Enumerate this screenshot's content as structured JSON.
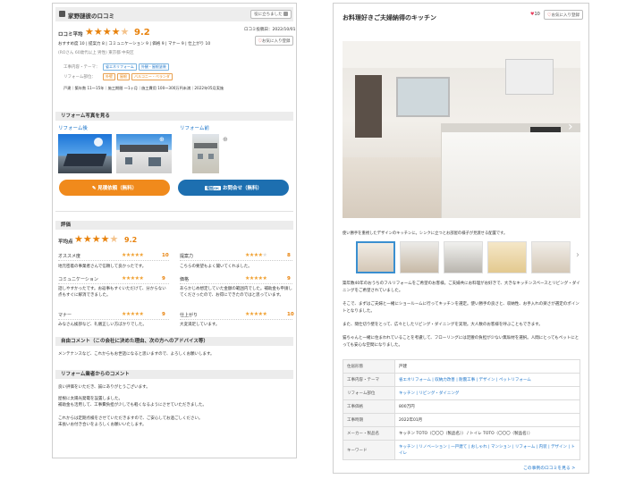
{
  "left": {
    "title": "家野謎彼のロコミ",
    "helpful_button": "役に立ちました",
    "rating_label": "ロコミ平均",
    "rating_value": "9.2",
    "posted_date": "ロコミ投稿日：2022/10/01",
    "fav_button": "お気に入り登録",
    "sub_scores": "おすすめ度 10 | 提案力 8 | コミュニケーション 9 | 価格 9 | マナー 9 | 仕上がり 10",
    "user_meta": "(ROさん 60歳代以上 男性) 東京都 中央区",
    "info": {
      "label1": "工事内容・テーマ：",
      "tags1": [
        "省エネリフォーム",
        "外観・屋根塗装"
      ],
      "label2": "リフォーム部位：",
      "tags2": [
        "外壁",
        "屋根",
        "バルコニー・ベランダ"
      ],
      "details": "戸建｜築年数 11〜15年｜施工期間 〜1ヶ月｜施工費用 100〜300万円未満｜2022年05月実施"
    },
    "photos_head": "リフォーム写真を見る",
    "after_label": "リフォーム後",
    "before_label": "リフォーム前",
    "estimate_button": "見積依頼（無料）",
    "inquiry_badge": "電話OK",
    "inquiry_button": "お問合せ（無料）",
    "eval_head": "評価",
    "avg_label": "平均点",
    "avg_value": "9.2",
    "evals": [
      {
        "name": "オススメ度",
        "score": "10",
        "text": "地元密着の事業者さんで信頼して良かったです。"
      },
      {
        "name": "提案力",
        "score": "8",
        "text": "こちらの要望もよく聞いてくれました。"
      },
      {
        "name": "コミュニケーション",
        "score": "9",
        "text": "話しやすかったです。お返事もすぐいただけて、分からない点もすぐに解消できました。"
      },
      {
        "name": "価格",
        "score": "9",
        "text": "あらかじめ想定していた金額の範囲内でした。補助金も申請してくださったので、お得にできたのではと思っています。"
      },
      {
        "name": "マナー",
        "score": "9",
        "text": "みなさん挨拶など、礼儀正しい方ばかりでした。"
      },
      {
        "name": "仕上がり",
        "score": "10",
        "text": "大変満足しています。"
      }
    ],
    "free_head": "自由コメント（この会社に決めた理由、次の方へのアドバイス等）",
    "free_text": "メンテナンスなど、これからもお世話になると思いますので、よろしくお願いします。",
    "company_head": "リフォーム業者からのコメント",
    "company_text": [
      "良い評価をいただき、誠にありがとうございます。",
      "屋根に太陽光発電を設置しました。\n補助金も活用して、工事費負担が少しでも軽くなるようにさせていただきました。",
      "これからは定期点検をさせていただきますので、ご安心してお過ごしください。\n末長いお付き合いをよろしくお願いいたします。"
    ]
  },
  "right": {
    "title": "お料理好きご夫婦納得のキッチン",
    "likes": "10",
    "fav_button": "お気に入り登録",
    "caption": "使い勝手を重視したデザインのキッチンに。シンクに立つとお部屋の様子が見渡せる配置です。",
    "desc1": "築年数40年のおうちのフルリフォームをご希望のお客様。ご夫婦共にお料理がお好きで、大きなキッチンスペースとリビング・ダイニングをご希望されていました。",
    "desc2": "そこで、まずはご夫婦と一緒にショールームに行ってキッチンを選定。使い勝手の良さと、収納性、お手入れの楽さが選定のポイントとなりました。",
    "desc3": "また、間仕切り壁をとって、広々としたリビング・ダイニングを実現。大人数のお客様を呼ぶこともできます。",
    "desc4": "猫ちゃんと一緒に住まわれていることを考慮して、フローリングには足腰の負担が少ない無垢材を選択。人間にとってもペットにとっても安心な空間になりました。",
    "spec": [
      {
        "k": "住居形態",
        "v": [
          "戸建"
        ],
        "link": false
      },
      {
        "k": "工事内容・テーマ",
        "v": [
          "省エネリフォーム",
          "収納力改善",
          "耐震工事",
          "デザイン",
          "ペットリフォーム"
        ],
        "link": true
      },
      {
        "k": "リフォーム部位",
        "v": [
          "キッチン",
          "リビング・ダイニング"
        ],
        "link": true
      },
      {
        "k": "工事価格",
        "v": [
          "800万円"
        ],
        "link": false
      },
      {
        "k": "工事時期",
        "v": [
          "2022年01月"
        ],
        "link": false
      },
      {
        "k": "メーカー・製品名",
        "v": [
          "キッチン TOTO（〇〇〇（製品名））",
          "トイレ TOTO（〇〇〇（製品名））"
        ],
        "link": false
      },
      {
        "k": "キーワード",
        "v": [
          "キッチン",
          "リノベーション",
          "一戸建て",
          "おしゃれ",
          "マンション",
          "リフォーム",
          "内装",
          "デザイン",
          "トイレ"
        ],
        "link": true
      }
    ],
    "footer_link": "この事例のロコミを見る >"
  },
  "colors": {
    "accent": "#e8820c",
    "link": "#1a73c9",
    "estimate": "#f08a1c",
    "inquiry": "#1d6fb0"
  }
}
